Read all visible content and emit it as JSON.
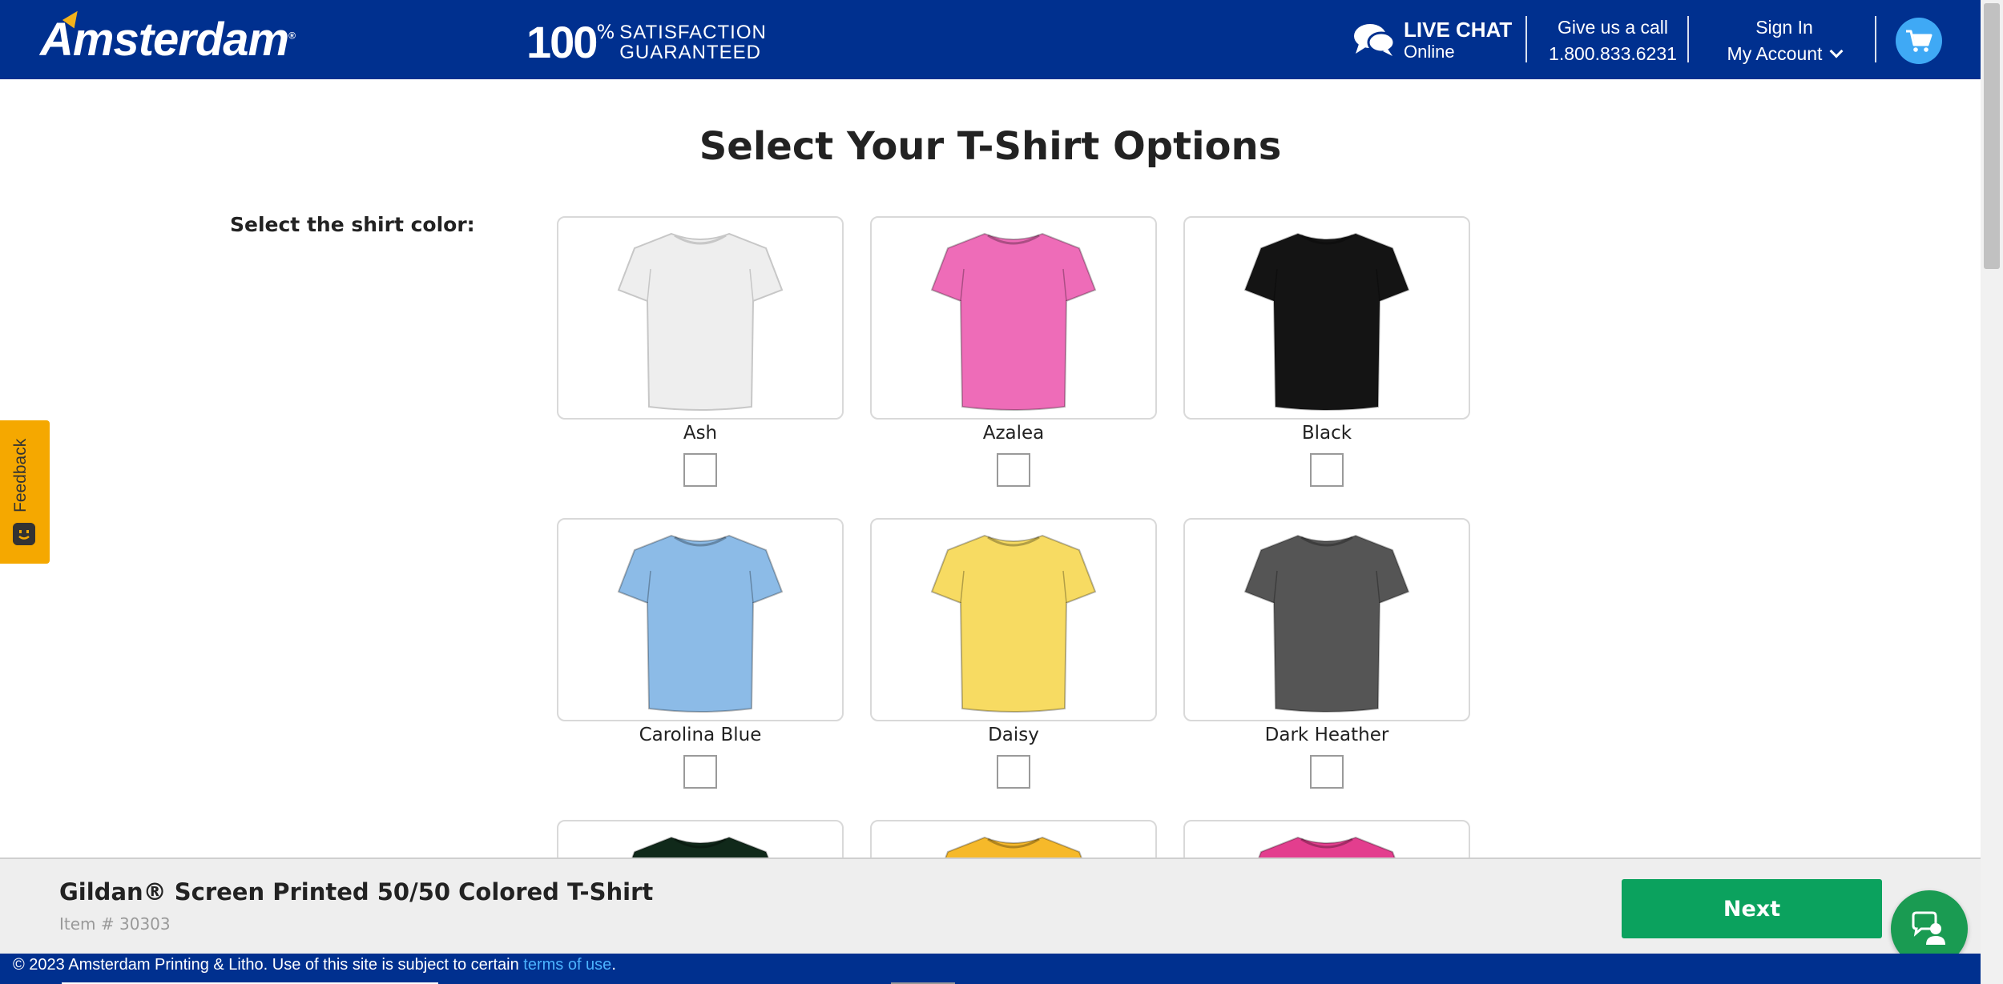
{
  "header": {
    "logo_text": "Amsterdam",
    "logo_reg": "®",
    "guarantee_percent": "100",
    "guarantee_percent_sign": "%",
    "guarantee_line1": "SATISFACTION",
    "guarantee_line2": "GUARANTEED",
    "chat_title": "LIVE CHAT",
    "chat_status": "Online",
    "call_label": "Give us a call",
    "call_number": "1.800.833.6231",
    "signin_label": "Sign In",
    "account_label": "My Account",
    "brand_color": "#00308f",
    "accent_color": "#3fa9f5"
  },
  "main": {
    "title": "Select Your T-Shirt Options",
    "color_label": "Select the shirt color:",
    "colors": [
      {
        "name": "Ash",
        "hex": "#eeeeee",
        "checked": false
      },
      {
        "name": "Azalea",
        "hex": "#ee6cb8",
        "checked": false
      },
      {
        "name": "Black",
        "hex": "#141414",
        "checked": false
      },
      {
        "name": "Carolina Blue",
        "hex": "#8cbbe7",
        "checked": false
      },
      {
        "name": "Daisy",
        "hex": "#f7db62",
        "checked": false
      },
      {
        "name": "Dark Heather",
        "hex": "#555555",
        "checked": false
      },
      {
        "name": "",
        "hex": "#10291a",
        "checked": false
      },
      {
        "name": "",
        "hex": "#f6b92a",
        "checked": false
      },
      {
        "name": "",
        "hex": "#e33e8e",
        "checked": false
      }
    ]
  },
  "feedback": {
    "label": "Feedback",
    "color": "#f5a800"
  },
  "bottom_bar": {
    "product_name": "Gildan® Screen Printed 50/50 Colored T-Shirt",
    "item_number": "Item # 30303",
    "next_label": "Next",
    "next_color": "#0ba25e"
  },
  "footer": {
    "copyright": "© 2023 Amsterdam Printing & Litho. Use of this site is subject to certain ",
    "terms_link": "terms of use",
    "end": "."
  }
}
